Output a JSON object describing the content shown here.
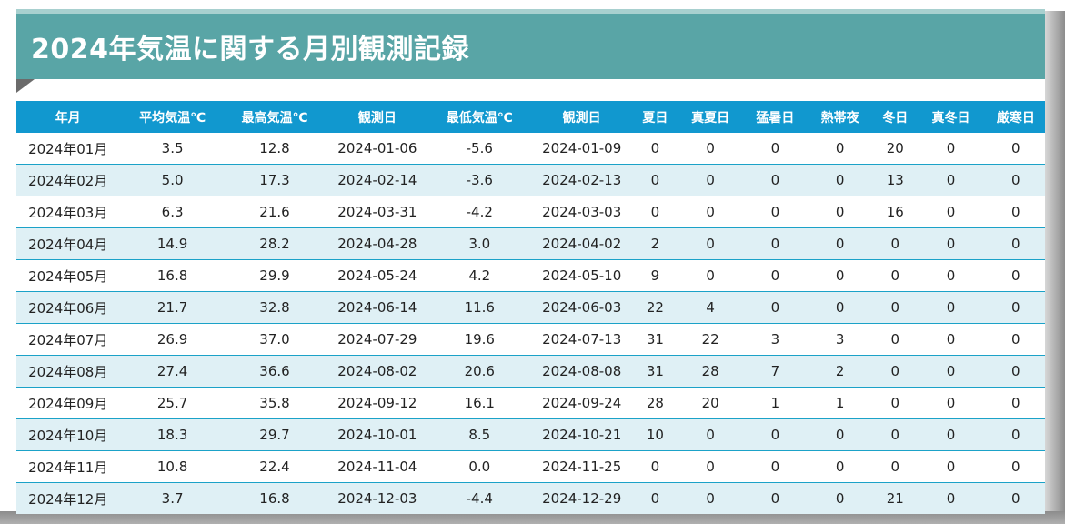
{
  "title": "2024年気温に関する月別観測記録",
  "colors": {
    "banner": "#59a5a6",
    "header": "#1198cf",
    "row_alt": "#dff0f5",
    "row_border": "#1ba2c8"
  },
  "columns": [
    "年月",
    "平均気温℃",
    "最高気温℃",
    "観測日",
    "最低気温℃",
    "観測日",
    "夏日",
    "真夏日",
    "猛暑日",
    "熱帯夜",
    "冬日",
    "真冬日",
    "厳寒日"
  ],
  "rows": [
    [
      "2024年01月",
      "3.5",
      "12.8",
      "2024-01-06",
      "-5.6",
      "2024-01-09",
      "0",
      "0",
      "0",
      "0",
      "20",
      "0",
      "0"
    ],
    [
      "2024年02月",
      "5.0",
      "17.3",
      "2024-02-14",
      "-3.6",
      "2024-02-13",
      "0",
      "0",
      "0",
      "0",
      "13",
      "0",
      "0"
    ],
    [
      "2024年03月",
      "6.3",
      "21.6",
      "2024-03-31",
      "-4.2",
      "2024-03-03",
      "0",
      "0",
      "0",
      "0",
      "16",
      "0",
      "0"
    ],
    [
      "2024年04月",
      "14.9",
      "28.2",
      "2024-04-28",
      "3.0",
      "2024-04-02",
      "2",
      "0",
      "0",
      "0",
      "0",
      "0",
      "0"
    ],
    [
      "2024年05月",
      "16.8",
      "29.9",
      "2024-05-24",
      "4.2",
      "2024-05-10",
      "9",
      "0",
      "0",
      "0",
      "0",
      "0",
      "0"
    ],
    [
      "2024年06月",
      "21.7",
      "32.8",
      "2024-06-14",
      "11.6",
      "2024-06-03",
      "22",
      "4",
      "0",
      "0",
      "0",
      "0",
      "0"
    ],
    [
      "2024年07月",
      "26.9",
      "37.0",
      "2024-07-29",
      "19.6",
      "2024-07-13",
      "31",
      "22",
      "3",
      "3",
      "0",
      "0",
      "0"
    ],
    [
      "2024年08月",
      "27.4",
      "36.6",
      "2024-08-02",
      "20.6",
      "2024-08-08",
      "31",
      "28",
      "7",
      "2",
      "0",
      "0",
      "0"
    ],
    [
      "2024年09月",
      "25.7",
      "35.8",
      "2024-09-12",
      "16.1",
      "2024-09-24",
      "28",
      "20",
      "1",
      "1",
      "0",
      "0",
      "0"
    ],
    [
      "2024年10月",
      "18.3",
      "29.7",
      "2024-10-01",
      "8.5",
      "2024-10-21",
      "10",
      "0",
      "0",
      "0",
      "0",
      "0",
      "0"
    ],
    [
      "2024年11月",
      "10.8",
      "22.4",
      "2024-11-04",
      "0.0",
      "2024-11-25",
      "0",
      "0",
      "0",
      "0",
      "0",
      "0",
      "0"
    ],
    [
      "2024年12月",
      "3.7",
      "16.8",
      "2024-12-03",
      "-4.4",
      "2024-12-29",
      "0",
      "0",
      "0",
      "0",
      "21",
      "0",
      "0"
    ]
  ]
}
